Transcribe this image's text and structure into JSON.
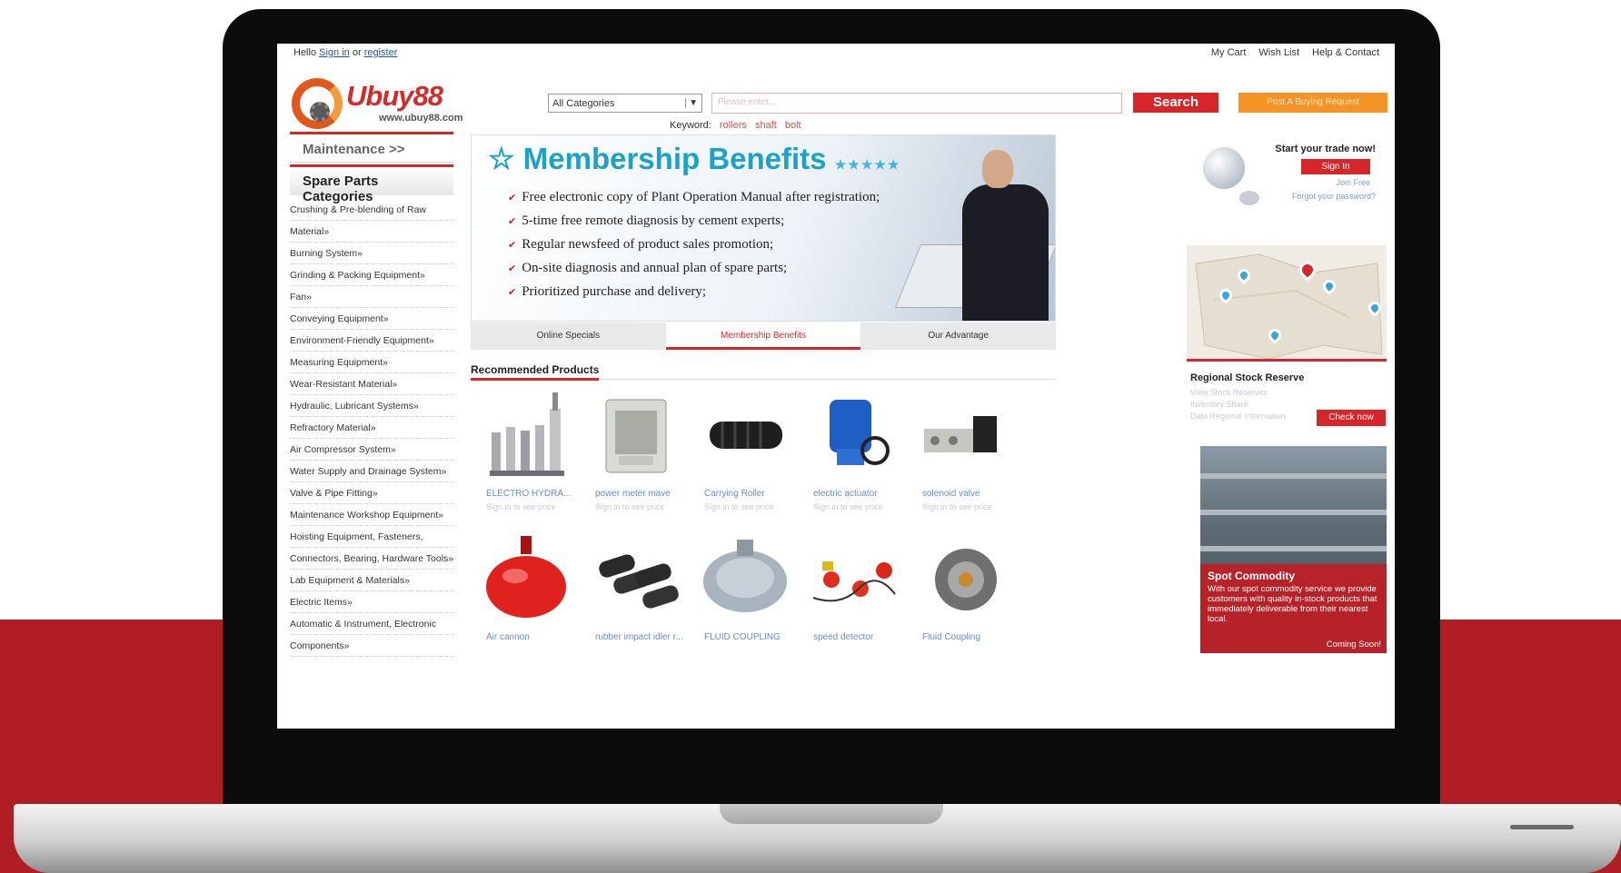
{
  "topbar": {
    "hello": "Hello",
    "sign_in": "Sign in",
    "or": "or",
    "register": "register",
    "links": [
      "My Cart",
      "Wish List",
      "Help & Contact"
    ]
  },
  "brand": {
    "name": "Ubuy88",
    "url": "www.ubuy88.com"
  },
  "search": {
    "category": "All Categories",
    "placeholder": "Please enter...",
    "button": "Search",
    "buying_button": "Post A Buying Request",
    "keyword_label": "Keyword:",
    "keywords": [
      "rollers",
      "shaft",
      "bolt"
    ]
  },
  "sidebar": {
    "maintenance": "Maintenance >>",
    "categories_title": "Spare Parts Categories",
    "categories": [
      "Crushing & Pre-blending of Raw",
      "Material»",
      "Burning System»",
      "Grinding & Packing Equipment»",
      "Fan»",
      "Conveying Equipment»",
      "Environment-Friendly Equipment»",
      "Measuring Equipment»",
      "Wear-Resistant Material»",
      "Hydraulic, Lubricant Systems»",
      "Refractory Material»",
      "Air Compressor System»",
      "Water Supply and Drainage System»",
      "Valve & Pipe Fitting»",
      "Maintenance Workshop Equipment»",
      "Hoisting Equipment, Fasteners,",
      "Connectors, Bearing, Hardware Tools»",
      "Lab Equipment & Materials»",
      "Electric Items»",
      "Automatic & Instrument, Electronic",
      "Components»"
    ]
  },
  "banner": {
    "title": "Membership Benefits",
    "stars": "★★★★★",
    "star_icon": "☆",
    "check_icon": "✔",
    "benefits": [
      "Free electronic copy of Plant Operation Manual after registration;",
      "5-time free remote diagnosis by cement experts;",
      "Regular newsfeed of product sales promotion;",
      "On-site diagnosis and annual plan of spare parts;",
      "Prioritized purchase and delivery;"
    ]
  },
  "tabs": [
    "Online Specials",
    "Membership Benefits",
    "Our Advantage"
  ],
  "recommended": {
    "title": "Recommended Products",
    "products": [
      {
        "name": "ELECTRO HYDRA...",
        "price": "Sign in to see price"
      },
      {
        "name": "power meter mave",
        "price": "Sign in to see price"
      },
      {
        "name": "Carrying Roller",
        "price": "Sign in to see price"
      },
      {
        "name": "electric actuator",
        "price": "Sign in to see price"
      },
      {
        "name": "solenoid valve",
        "price": "Sign in to see price"
      },
      {
        "name": "Air cannon",
        "price": ""
      },
      {
        "name": "rubber impact idler r...",
        "price": ""
      },
      {
        "name": "FLUID COUPLING",
        "price": ""
      },
      {
        "name": "speed detector",
        "price": ""
      },
      {
        "name": "Fluid Coupling",
        "price": ""
      }
    ]
  },
  "right": {
    "login_title": "Start your trade now!",
    "sign_in": "Sign In",
    "join": "Join Free",
    "forgot": "Forgot your password?",
    "stock_title": "Regional Stock Reserve",
    "stock_lines": [
      "View Stock Reserves",
      "Inventory Share",
      "Data Regional Information"
    ],
    "check_now": "Check now",
    "spot_title": "Spot Commodity",
    "spot_text": "With our spot commodity service we provide customers with quality in-stock products that immediately deliverable from their nearest local.",
    "coming_soon": "Coming Soon!"
  },
  "colors": {
    "brand_red": "#d7262a",
    "band_red": "#b11d24",
    "accent_orange": "#f39424",
    "banner_blue": "#1aa2c8"
  }
}
